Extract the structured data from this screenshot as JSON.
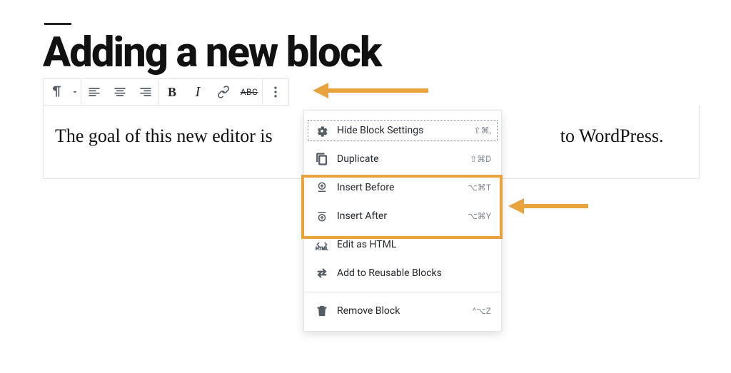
{
  "heading": "Adding a new block",
  "paragraph_before": "The goal of this new editor is ",
  "paragraph_after": " to WordPress.",
  "toolbar": {
    "paragraph_icon": "pilcrow",
    "bold_label": "B",
    "italic_label": "I",
    "strike_label": "ABC"
  },
  "menu": {
    "hide_settings": {
      "label": "Hide Block Settings",
      "shortcut": "⇧⌘,"
    },
    "duplicate": {
      "label": "Duplicate",
      "shortcut": "⇧⌘D"
    },
    "insert_before": {
      "label": "Insert Before",
      "shortcut": "⌥⌘T"
    },
    "insert_after": {
      "label": "Insert After",
      "shortcut": "⌥⌘Y"
    },
    "edit_html": {
      "label": "Edit as HTML",
      "shortcut": ""
    },
    "reusable": {
      "label": "Add to Reusable Blocks",
      "shortcut": ""
    },
    "remove": {
      "label": "Remove Block",
      "shortcut": "^⌥Z"
    },
    "html_icon_text": "HTML"
  }
}
